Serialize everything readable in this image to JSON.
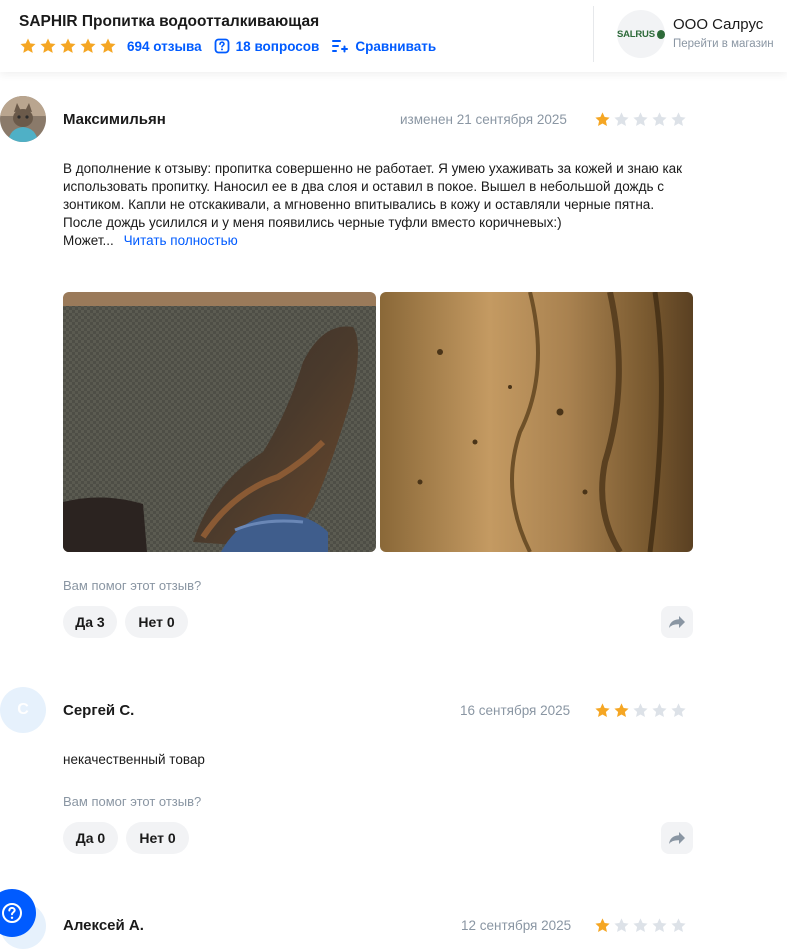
{
  "header": {
    "product_title": "SAPHIR Пропитка водоотталкивающая",
    "rating_stars": 5,
    "reviews_link": "694 отзыва",
    "questions_link": "18 вопросов",
    "compare_link": "Сравнивать",
    "shop_logo_text": "SALRUS",
    "shop_name": "ООО Салрус",
    "shop_subtitle": "Перейти в магазин"
  },
  "colors": {
    "accent": "#005bff",
    "star": "#f5a623",
    "star_empty": "#dde2e8",
    "muted": "#8a96a3"
  },
  "reviews": [
    {
      "author": "Максимильян",
      "date": "изменен 21 сентября 2025",
      "rating": 1,
      "text": "В дополнение к отзыву: пропитка совершенно не работает. Я умею ухаживать за кожей и знаю как использовать пропитку. Наносил ее в два слоя и оставил в покое. Вышел в небольшой дождь с зонтиком. Капли не отскакивали, а мгновенно впитывались в кожу и оставляли черные пятна. После дождь усилился и у меня появились черные туфли вместо коричневых:)",
      "text_more_prefix": "Может...",
      "read_more": "Читать полностью",
      "helpful_question": "Вам помог этот отзыв?",
      "yes_label": "Да 3",
      "no_label": "Нет 0"
    },
    {
      "author": "Сергей С.",
      "avatar_letter": "С",
      "date": "16 сентября 2025",
      "rating": 2,
      "text": "некачественный товар",
      "helpful_question": "Вам помог этот отзыв?",
      "yes_label": "Да 0",
      "no_label": "Нет 0"
    },
    {
      "author": "Алексей А.",
      "date": "12 сентября 2025",
      "rating": 1
    }
  ]
}
